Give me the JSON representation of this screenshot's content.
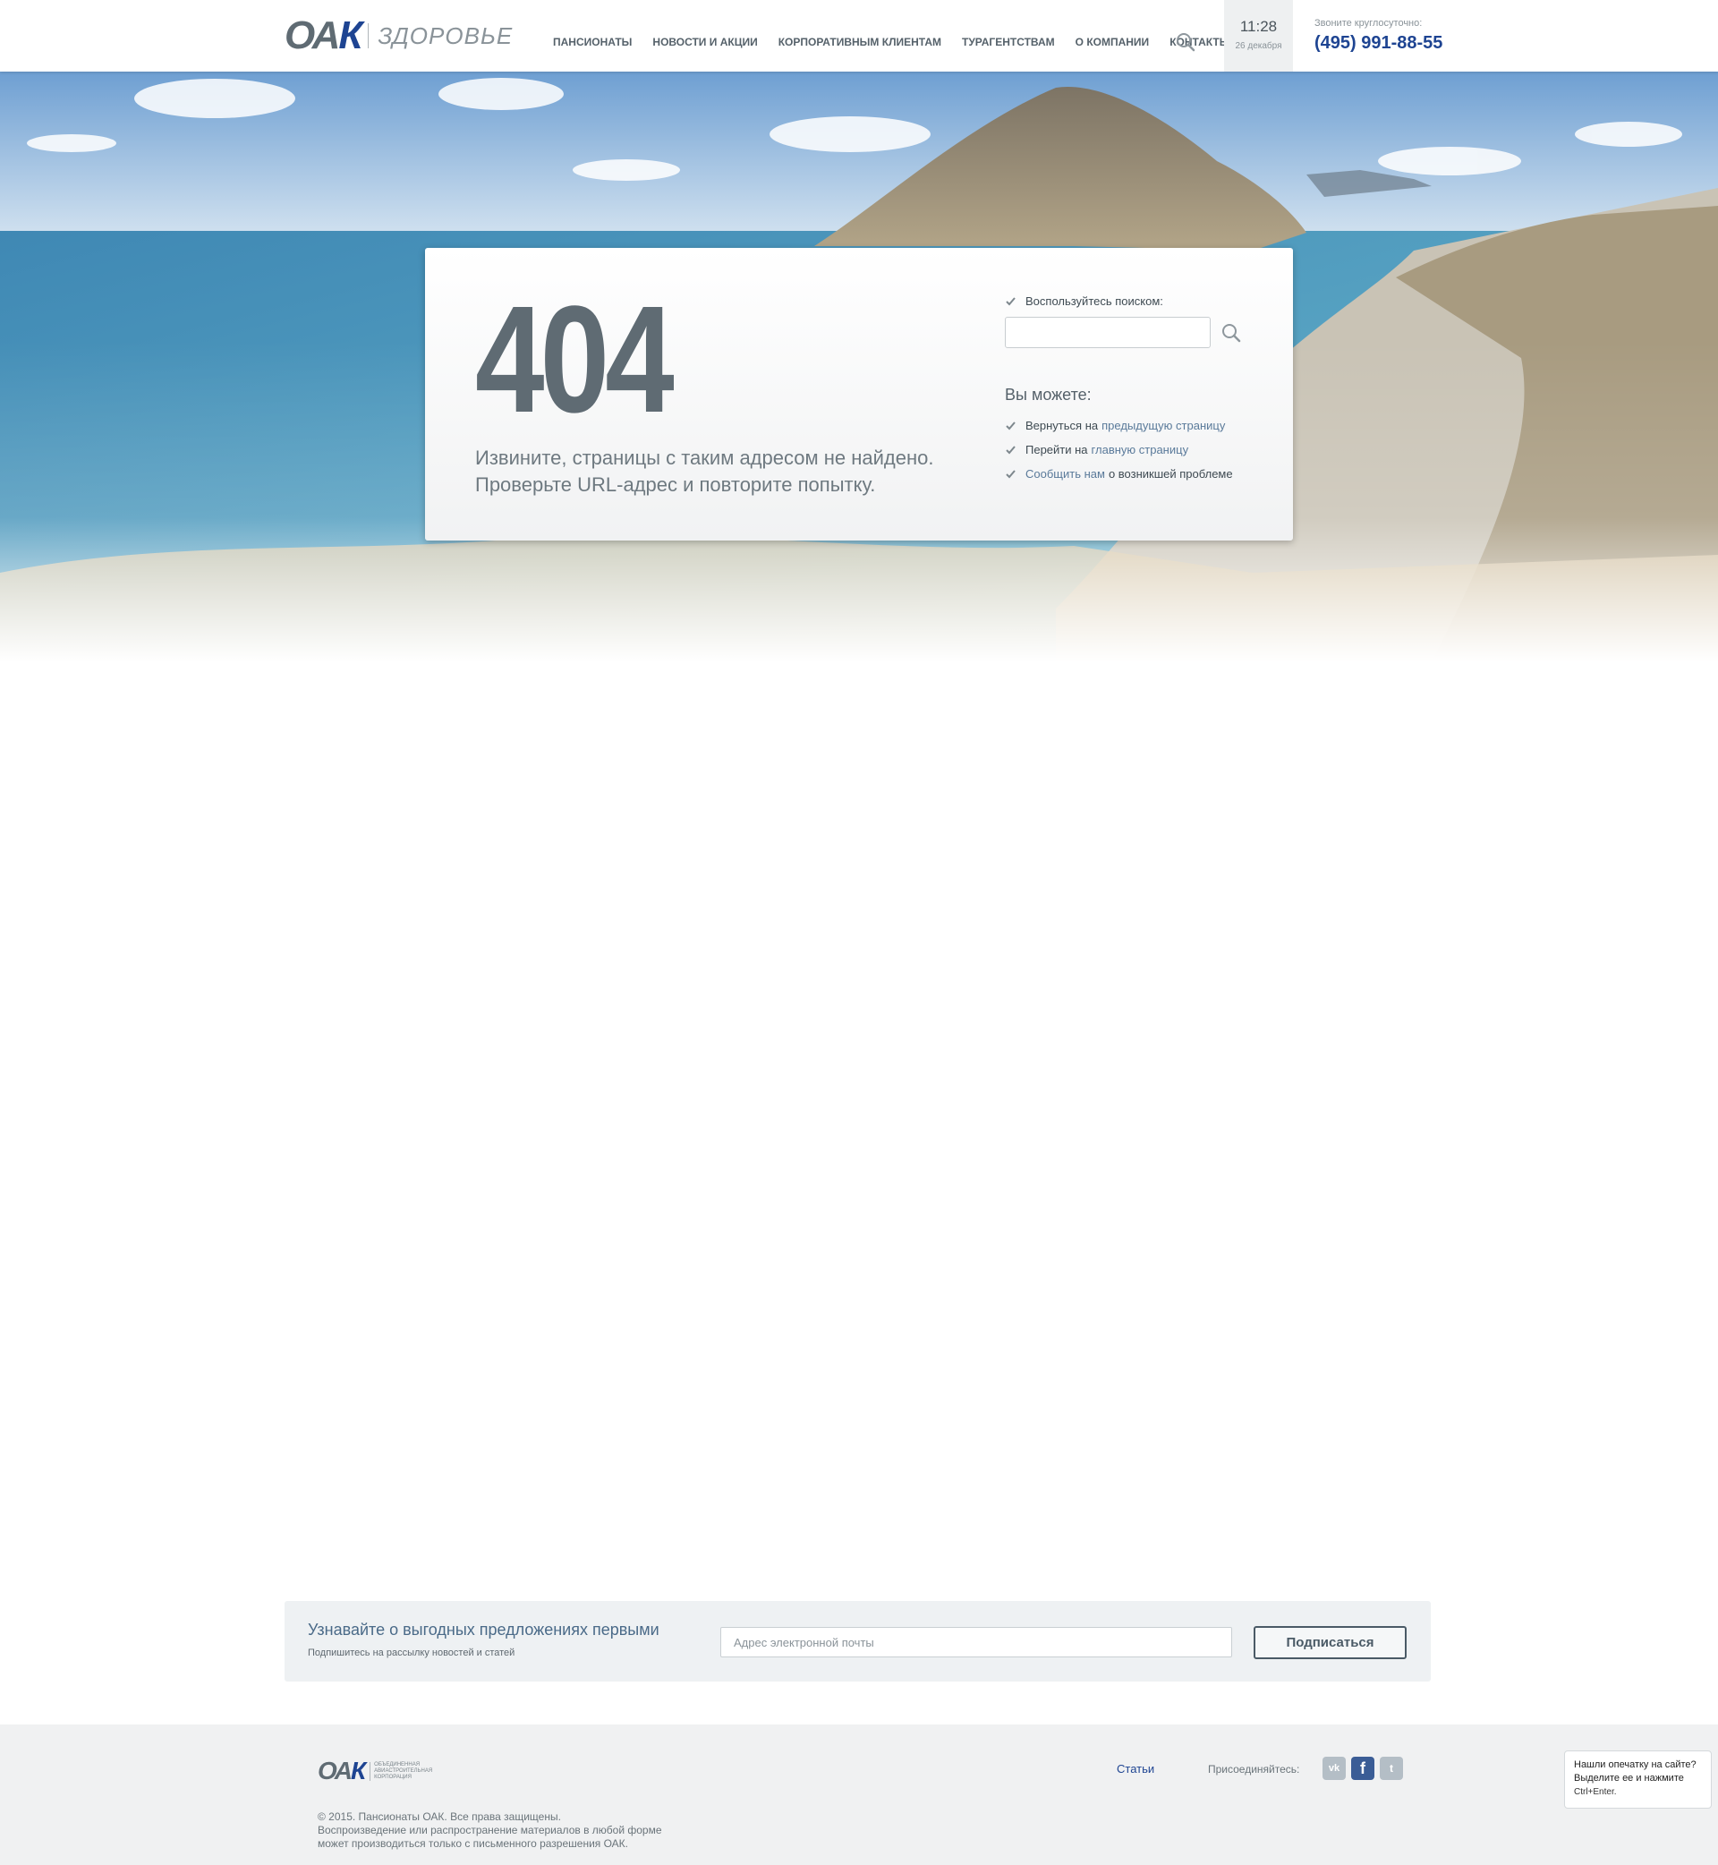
{
  "header": {
    "logo_text": "ОАК",
    "logo_sub": "ЗДОРОВЬЕ",
    "nav": [
      "ПАНСИОНАТЫ",
      "НОВОСТИ И АКЦИИ",
      "КОРПОРАТИВНЫМ КЛИЕНТАМ",
      "ТУРАГЕНТСТВАМ",
      "О КОМПАНИИ",
      "КОНТАКТЫ"
    ],
    "time": "11:28",
    "date": "26 декабря",
    "phone_label": "Звоните круглосуточно:",
    "phone": "(495) 991-88-55"
  },
  "error": {
    "code": "404",
    "line1": "Извините, страницы с таким адресом не найдено.",
    "line2": "Проверьте URL-адрес и повторите попытку.",
    "search_label": "Воспользуйтесь поиском:",
    "you_can": "Вы можете:",
    "options": [
      {
        "pre": "Вернуться на",
        "link": "предыдущую страницу",
        "post": ""
      },
      {
        "pre": "Перейти на",
        "link": "главную страницу",
        "post": ""
      },
      {
        "pre": "",
        "link": "Сообщить нам",
        "post": "о возникшей проблеме"
      }
    ]
  },
  "subscribe": {
    "title": "Узнавайте о выгодных предложениях первыми",
    "note": "Подпишитесь на рассылку новостей и статей",
    "placeholder": "Адрес электронной почты",
    "button": "Подписаться"
  },
  "footer": {
    "logo_text": "ОАК",
    "logo_sub": "Объединенная авиастроительная корпорация",
    "copyright_1": "© 2015. Пансионаты ОАК. Все права защищены.",
    "copyright_2": "Воспроизведение или распространение материалов в любой форме",
    "copyright_3": "может производиться только с письменного разрешения ОАК.",
    "articles_link": "Статьи",
    "join_label": "Присоединяйтесь:",
    "social": [
      "vk-icon",
      "facebook-icon",
      "twitter-icon"
    ]
  },
  "typo_widget": {
    "line1": "Нашли опечатку на сайте?",
    "line2": "Выделите ее и нажмите",
    "line3": "Ctrl+Enter."
  },
  "colors": {
    "brand_blue": "#1e4492",
    "brand_gray": "#5f6b73",
    "link": "#5a7a9a"
  }
}
